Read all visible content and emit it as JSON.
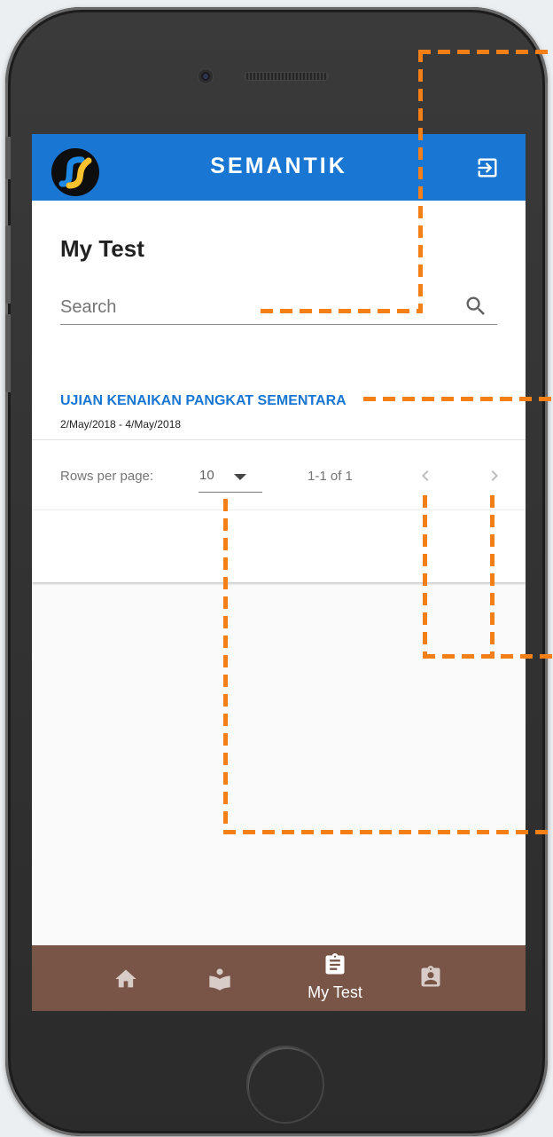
{
  "appbar": {
    "title": "SEMANTIK",
    "logo_icon": "semantik-logo-icon",
    "exit_icon": "exit-to-app-icon"
  },
  "page": {
    "title": "My Test"
  },
  "search": {
    "placeholder": "Search",
    "value": "",
    "icon": "search-icon"
  },
  "tests": [
    {
      "title": "UJIAN KENAIKAN PANGKAT SEMENTARA",
      "dates": "2/May/2018 - 4/May/2018"
    }
  ],
  "pagination": {
    "rows_label": "Rows per page:",
    "rows_value": "10",
    "range": "1-1 of 1",
    "prev_icon": "chevron-left-icon",
    "next_icon": "chevron-right-icon"
  },
  "bottom_nav": {
    "items": [
      {
        "icon": "home-icon",
        "label": "",
        "active": false
      },
      {
        "icon": "book-reader-icon",
        "label": "",
        "active": false
      },
      {
        "icon": "clipboard-list-icon",
        "label": "My Test",
        "active": true
      },
      {
        "icon": "clipboard-account-icon",
        "label": "",
        "active": false
      }
    ]
  },
  "colors": {
    "primary": "#1976d2",
    "bottom_nav": "#795548",
    "annotation": "#f57f17"
  }
}
